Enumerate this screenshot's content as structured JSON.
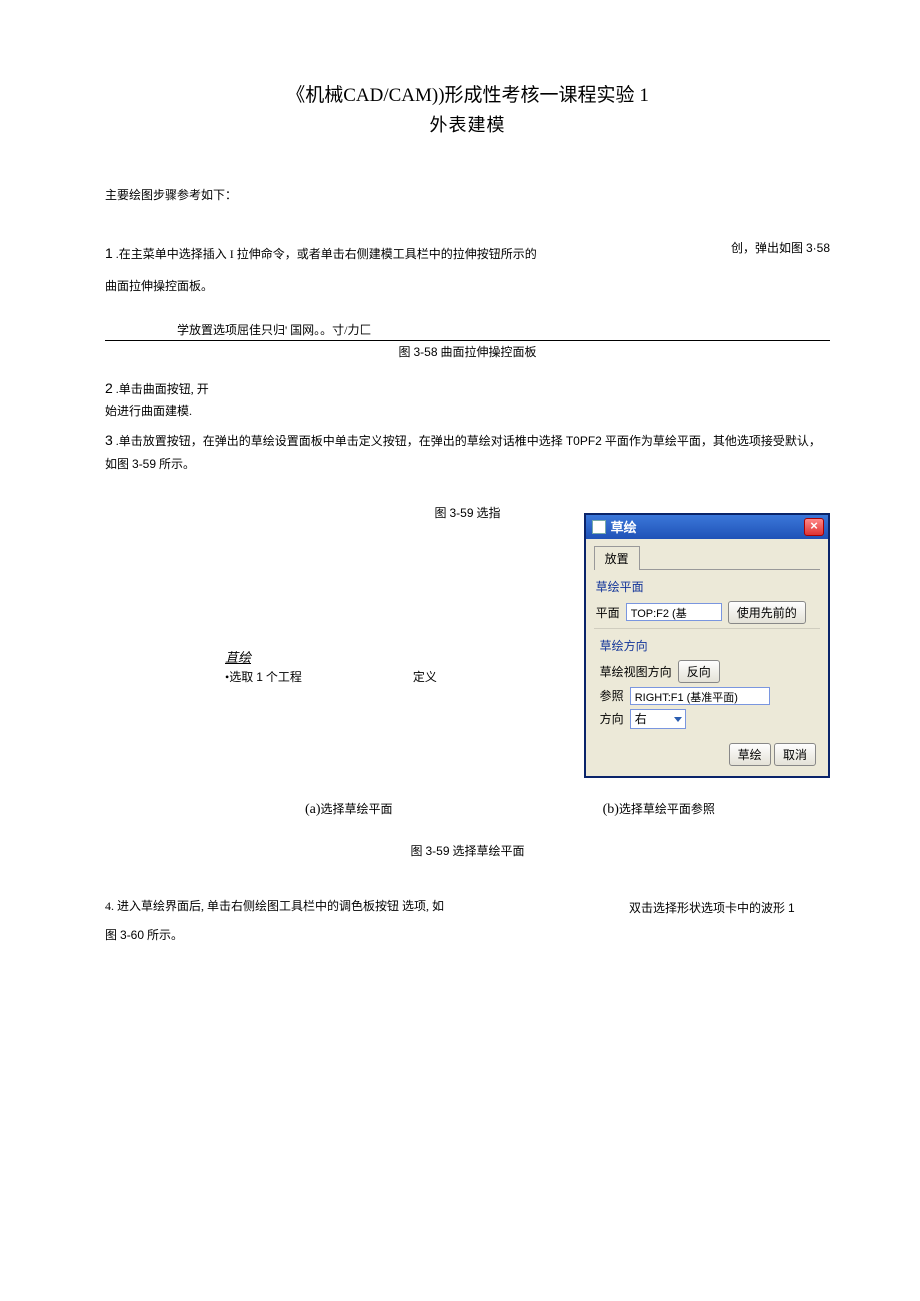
{
  "title": {
    "line1_a": "《机械",
    "line1_b": "CAD/CAM))",
    "line1_c": "形成性考核一课程实验",
    "line1_d": "1",
    "line2": "外表建模"
  },
  "intro": "主要绘图步骤参考如下：",
  "step1": {
    "right_note_a": "创，弹出如图",
    "right_note_b": "3·58",
    "num": "1",
    "text": " .在主菜单中选择插入 I 拉伸命令，或者单击右侧建模工具栏中的拉伸按钮所示的",
    "line2": "曲面拉伸操控面板。"
  },
  "indent_line": "学放置选项屈佳只归' 国网。。寸/力匚",
  "fig358": {
    "a": "图",
    "b": "3-58",
    "c": " 曲面拉伸操控面板"
  },
  "step2": {
    "num": "2",
    "text": " .单击曲面按钮, 开",
    "cont": "始进行曲面建模."
  },
  "step3": {
    "num": "3",
    "text_a": " .单击放置按钮，在弹出的草绘设置面板中单击定义按钮，在弹出的草绘对话椎中选择",
    "text_b": "T0PF2",
    "text_c": " 平面作为草绘平面，其他选项接受默认，如图",
    "text_d": "3-59",
    "text_e": " 所示。"
  },
  "fig359_pre": {
    "a": "图",
    "b": "3-59",
    "c": " 选指"
  },
  "left_panel": {
    "heading": "苴绘",
    "sel_a": "•选取",
    "sel_b": "1",
    "sel_c": " 个工程",
    "def": "定义"
  },
  "dialog": {
    "title": "草绘",
    "tab": "放置",
    "group1_title": "草绘平面",
    "plane_label": "平面",
    "plane_value": "TOP:F2 (基",
    "use_prev": "使用先前的",
    "group2_title": "草绘方向",
    "view_dir_label": "草绘视图方向",
    "reverse": "反向",
    "ref_label": "参照",
    "ref_value": "RIGHT:F1 (基准平面)",
    "dir_label": "方向",
    "dir_value": "右",
    "ok": "草绘",
    "cancel": "取消"
  },
  "ab": {
    "a_pre": "(a)",
    "a_txt": "选择草绘平面",
    "b_pre": "(b)",
    "b_txt": "选择草绘平面参照"
  },
  "fig359": {
    "a": "图",
    "b": "3-59",
    "c": " 选择草绘平面"
  },
  "step4": {
    "left": "4. 进入草绘界面后, 单击右侧绘图工具栏中的调色板按钮  选项, 如",
    "right_a": "双击选择形状选项卡中的波形",
    "right_b": "1",
    "line2_a": "图",
    "line2_b": "3-60",
    "line2_c": " 所示。"
  }
}
